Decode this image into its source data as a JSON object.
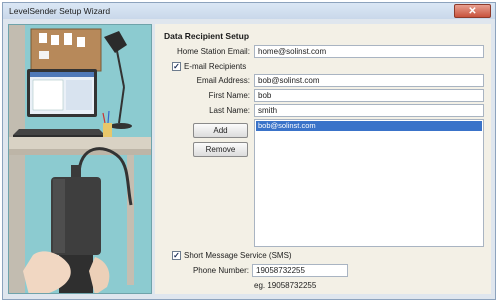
{
  "window": {
    "title": "LevelSender Setup Wizard",
    "close_glyph": "✕"
  },
  "section": {
    "heading": "Data Recipient Setup"
  },
  "home_station": {
    "label": "Home Station Email:",
    "value": "home@solinst.com"
  },
  "email_recipients": {
    "checkbox_label": "E-mail Recipients",
    "checked": true,
    "email_label": "Email Address:",
    "email_value": "bob@solinst.com",
    "first_label": "First Name:",
    "first_value": "bob",
    "last_label": "Last Name:",
    "last_value": "smith",
    "add_label": "Add",
    "remove_label": "Remove",
    "recipients": [
      "bob@solinst.com"
    ]
  },
  "sms": {
    "checkbox_label": "Short Message Service (SMS)",
    "checked": true,
    "phone_label": "Phone Number:",
    "phone_value": "19058732255",
    "example": "eg. 19058732255"
  },
  "colors": {
    "selection": "#3a73c9",
    "artwork_bg": "#88c6cc"
  },
  "icons": {
    "check": "✓"
  }
}
